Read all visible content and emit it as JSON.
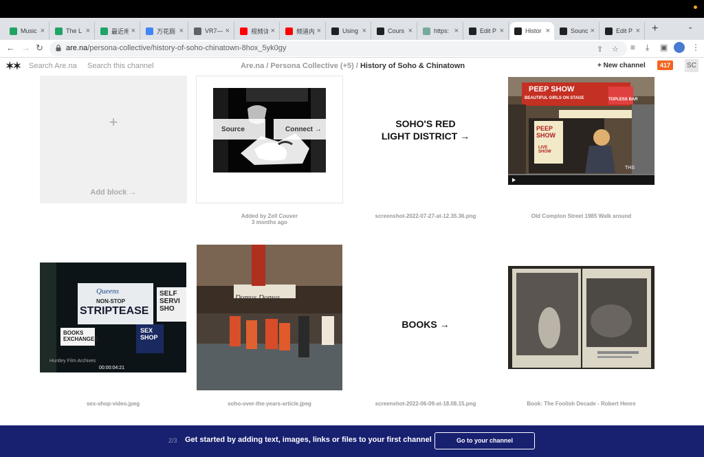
{
  "browser": {
    "tabs": [
      {
        "title": "Music",
        "favicon": "google-drive-icon",
        "color": "#1fa463"
      },
      {
        "title": "The L",
        "favicon": "google-drive-icon",
        "color": "#1fa463"
      },
      {
        "title": "最近用",
        "favicon": "google-drive-icon",
        "color": "#1fa463"
      },
      {
        "title": "万花厕",
        "favicon": "google-icon",
        "color": "#4285f4"
      },
      {
        "title": "VR7—V",
        "favicon": "globe-icon",
        "color": "#5f6368"
      },
      {
        "title": "视频详",
        "favicon": "youtube-icon",
        "color": "#ff0000"
      },
      {
        "title": "频道内",
        "favicon": "youtube-icon",
        "color": "#ff0000"
      },
      {
        "title": "Using",
        "favicon": "page-icon",
        "color": "#202124"
      },
      {
        "title": "Cours",
        "favicon": "arena-page-icon",
        "color": "#202124"
      },
      {
        "title": "https:",
        "favicon": "openai-icon",
        "color": "#74aa9c"
      },
      {
        "title": "Edit P",
        "favicon": "arena-page-icon",
        "color": "#202124"
      },
      {
        "title": "Histor",
        "favicon": "arena-logo-icon",
        "color": "#202124",
        "active": true
      },
      {
        "title": "Sounc",
        "favicon": "arena-page-icon",
        "color": "#202124"
      },
      {
        "title": "Edit P",
        "favicon": "arena-page-icon",
        "color": "#202124"
      }
    ],
    "url_host": "are.na",
    "url_path": "/persona-collective/history-of-soho-chinatown-8hox_5yk0gy"
  },
  "header": {
    "logo": "✶✶",
    "search_all": "Search Are.na",
    "search_channel": "Search this channel",
    "crumb_site": "Are.na",
    "crumb_sep1": " / ",
    "crumb_group": "Persona Collective",
    "crumb_group_count": " (+5)",
    "crumb_sep2": " / ",
    "crumb_channel": "History of Soho & Chinatown",
    "new_channel": "+  New channel",
    "count_badge": "417",
    "user_initials": "SC"
  },
  "blocks": {
    "add_block": {
      "plus": "+",
      "label": "Add block →"
    },
    "b2": {
      "source_btn": "Source",
      "connect_btn": "Connect →",
      "caption_line1": "Added by Zell Couver",
      "caption_line2": "3 months ago"
    },
    "b3": {
      "text_line1": "SOHO'S RED",
      "text_line2": "LIGHT DISTRICT  →",
      "caption": "screenshot-2022-07-27-at-12.35.36.png"
    },
    "b4": {
      "caption": "Old Compton Street 1985 Walk around",
      "sign1": "PEEP SHOW",
      "sign2": "BEAUTIFUL GIRLS ON STAGE",
      "sign3": "TOPLESS BAR",
      "sign4": "PEEP SHOW",
      "sign5": "LIVE SHOW",
      "watermark": "THS"
    },
    "b5": {
      "caption": "sex-shop-video.jpeg",
      "sign1": "Queens",
      "sign2": "NON-STOP",
      "sign3": "STRIPTEASE",
      "sign4": "SELF SERVI SHO",
      "sign5": "SEX SHOP",
      "sign6": "BOOKS EXCHANGES",
      "overlay_credit": "Huntley Film Archives",
      "timecode": "00:00:04:21"
    },
    "b6": {
      "caption": "soho-over-the-years-article.jpeg",
      "sign1": "Domus",
      "sign2": "Domus"
    },
    "b7": {
      "text": "BOOKS  →",
      "caption": "screenshot-2022-06-09-at-18.08.15.png"
    },
    "b8": {
      "caption": "Book: The Foolish Decade - Robert Henre"
    }
  },
  "banner": {
    "step": "2/3",
    "message": "Get started by adding text, images, links or files to your first channel",
    "cta": "Go to your channel"
  },
  "colors": {
    "accent_orange": "#f26522",
    "banner_bg": "#182070"
  }
}
